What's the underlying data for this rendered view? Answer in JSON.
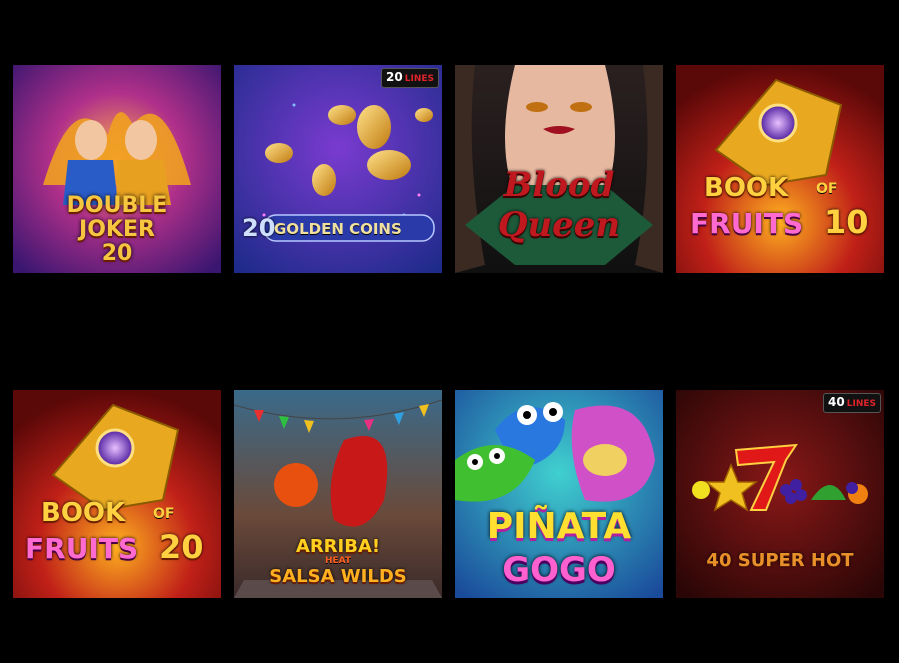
{
  "games": [
    {
      "id": "double-joker-20",
      "line1": "DOUBLE",
      "line2": "JOKER",
      "line3": "20"
    },
    {
      "id": "20-golden-coins",
      "num": "20",
      "name": "GOLDEN COINS",
      "badge_num": "20",
      "badge_text": "LINES"
    },
    {
      "id": "blood-queen",
      "line1": "Blood",
      "line2": "Queen"
    },
    {
      "id": "book-of-fruits-10",
      "line1": "BOOK",
      "of": "OF",
      "line2": "FRUITS",
      "num": "10"
    },
    {
      "id": "book-of-fruits-20",
      "line1": "BOOK",
      "of": "OF",
      "line2": "FRUITS",
      "num": "20"
    },
    {
      "id": "arriba-heat-salsa-wilds",
      "line1": "ARRIBA!",
      "line2": "HEAT",
      "line3": "SALSA WILDS"
    },
    {
      "id": "pinata-gogo",
      "line1": "PIÑATA",
      "line2": "GOGO"
    },
    {
      "id": "40-super-hot",
      "name": "40 SUPER HOT",
      "badge_num": "40",
      "badge_text": "LINES"
    }
  ],
  "colors": {
    "background": "#000000"
  }
}
